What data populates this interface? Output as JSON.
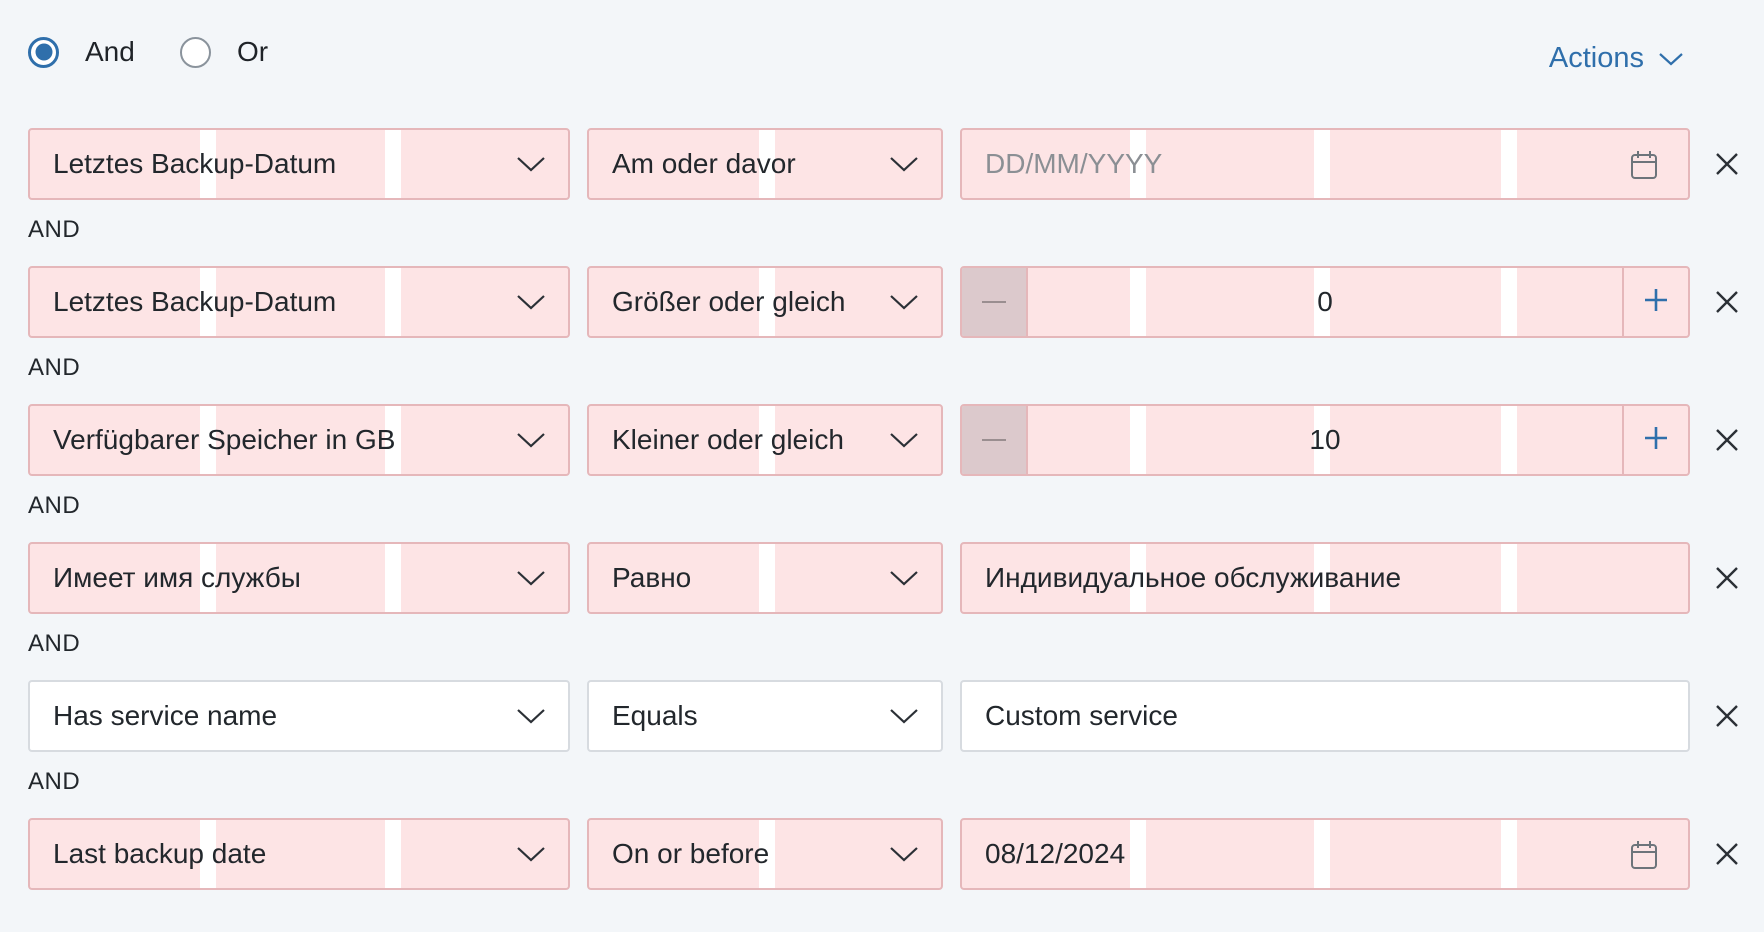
{
  "logic": {
    "options": [
      {
        "label": "And",
        "checked": true
      },
      {
        "label": "Or",
        "checked": false
      }
    ],
    "actions_label": "Actions"
  },
  "connector": "AND",
  "rows": [
    {
      "field": "Letztes Backup-Datum",
      "operator": "Am oder davor",
      "value_type": "date",
      "value": "",
      "placeholder": "DD/MM/YYYY",
      "highlighted": true
    },
    {
      "field": "Letztes Backup-Datum",
      "operator": "Größer oder gleich",
      "value_type": "number",
      "value": "0",
      "highlighted": true
    },
    {
      "field": "Verfügbarer Speicher in GB",
      "operator": "Kleiner oder gleich",
      "value_type": "number",
      "value": "10",
      "highlighted": true
    },
    {
      "field": "Имеет имя службы",
      "operator": "Равно",
      "value_type": "text",
      "value": "Индивидуальное обслуживание",
      "highlighted": true
    },
    {
      "field": "Has service name",
      "operator": "Equals",
      "value_type": "text",
      "value": "Custom service",
      "highlighted": false
    },
    {
      "field": "Last backup date",
      "operator": "On or before",
      "value_type": "date",
      "value": "08/12/2024",
      "highlighted": true
    }
  ],
  "colors": {
    "accent": "#2f6fab",
    "highlight_fill": "#fde4e5",
    "highlight_border": "#e5b7ba",
    "background": "#f3f6f9"
  }
}
